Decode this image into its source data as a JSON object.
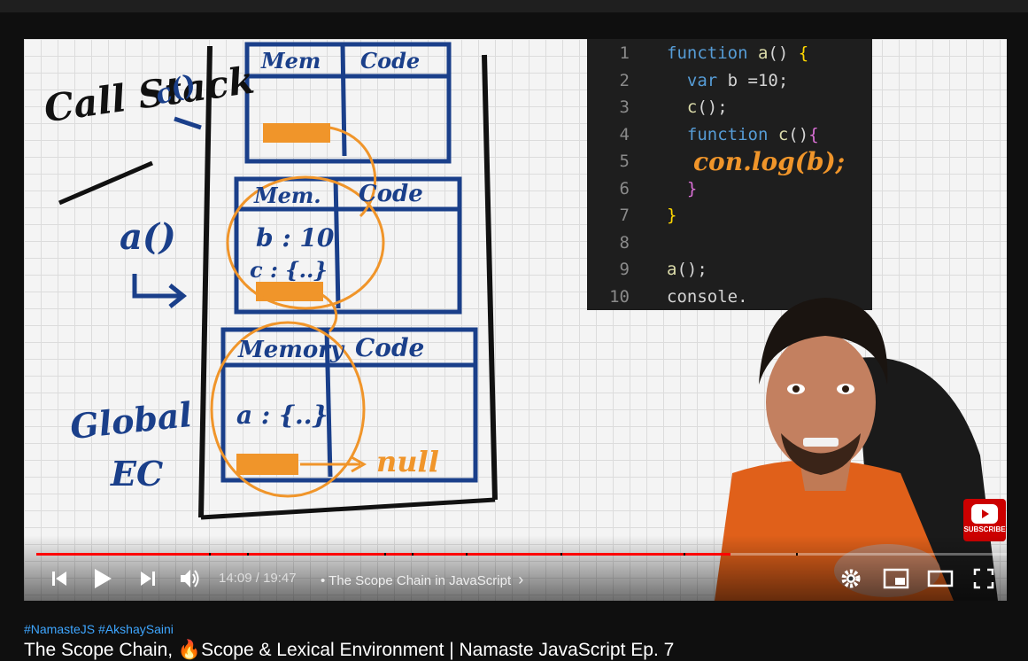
{
  "code": {
    "lines": [
      {
        "n": "1",
        "parts": [
          [
            "kw",
            "function "
          ],
          [
            "fn",
            "a"
          ],
          [
            "txt",
            "() "
          ],
          [
            "brace",
            "{"
          ]
        ]
      },
      {
        "n": "2",
        "parts": [
          [
            "txt",
            "  "
          ],
          [
            "kw",
            "var "
          ],
          [
            "txt",
            "b =10;"
          ]
        ]
      },
      {
        "n": "3",
        "parts": [
          [
            "txt",
            "  "
          ],
          [
            "fn",
            "c"
          ],
          [
            "txt",
            "();"
          ]
        ]
      },
      {
        "n": "4",
        "parts": [
          [
            "txt",
            "  "
          ],
          [
            "kw",
            "function "
          ],
          [
            "fn",
            "c"
          ],
          [
            "txt",
            "()"
          ],
          [
            "brace2",
            "{"
          ]
        ]
      },
      {
        "n": "5",
        "parts": [
          [
            "txt",
            "  "
          ]
        ]
      },
      {
        "n": "6",
        "parts": [
          [
            "txt",
            "  "
          ],
          [
            "brace2",
            "}"
          ]
        ]
      },
      {
        "n": "7",
        "parts": [
          [
            "brace",
            "}"
          ]
        ]
      },
      {
        "n": "8",
        "parts": []
      },
      {
        "n": "9",
        "parts": [
          [
            "fn",
            "a"
          ],
          [
            "txt",
            "();"
          ]
        ]
      },
      {
        "n": "10",
        "parts": [
          [
            "txt",
            "console."
          ]
        ]
      }
    ],
    "handwritten_line": "con.log(b);"
  },
  "whiteboard": {
    "call_stack_label": "Call Stack",
    "c_call": "c()",
    "a_call": "a()",
    "global_label": "Global",
    "ec_label": "EC",
    "frame_c": {
      "mem": "Mem",
      "code": "Code"
    },
    "frame_a": {
      "mem": "Mem.",
      "code": "Code",
      "b": "b : 10",
      "c": "c : {..}"
    },
    "frame_global": {
      "mem": "Memory",
      "code": "Code",
      "a": "a : {..}"
    },
    "null_label": "null"
  },
  "player": {
    "current_time": "14:09",
    "separator": "/",
    "duration": "19:47",
    "chapter_bullet": "•",
    "chapter_title": "The Scope Chain in JavaScript",
    "progress_fraction": 0.715,
    "subscribe_label": "SUBSCRIBE",
    "icons": [
      "previous-icon",
      "play-icon",
      "next-icon",
      "volume-icon",
      "settings-icon",
      "miniplayer-icon",
      "theater-icon",
      "fullscreen-icon"
    ]
  },
  "video": {
    "hashtags": "#NamasteJS #AkshaySaini",
    "title": "The Scope Chain, 🔥Scope & Lexical Environment | Namaste JavaScript Ep. 7"
  },
  "colors": {
    "progress": "#ff0000",
    "marker_blue": "#1a3f8a",
    "marker_orange": "#f0952a"
  }
}
